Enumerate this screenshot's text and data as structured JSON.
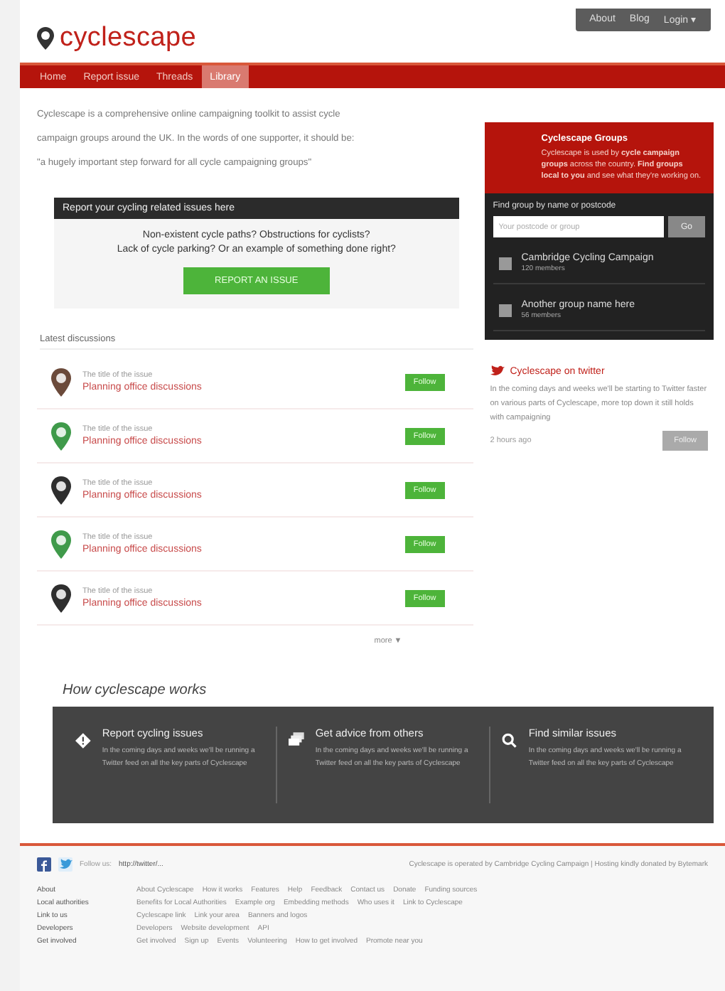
{
  "logo": {
    "text": "cyclescape"
  },
  "top_menu": [
    {
      "label": "About"
    },
    {
      "label": "Blog"
    },
    {
      "label": "Login ▾"
    }
  ],
  "nav_tabs": [
    {
      "label": "Home",
      "selected": false
    },
    {
      "label": "Report issue",
      "selected": false
    },
    {
      "label": "Threads",
      "selected": false
    },
    {
      "label": "Library",
      "selected": true
    }
  ],
  "intro": {
    "lines": [
      "Cyclescape is a comprehensive online campaigning toolkit to assist cycle",
      "campaign groups around the UK. In the words of one supporter, it should be:",
      "\"a hugely important step forward for all cycle campaigning groups\""
    ]
  },
  "report": {
    "title": "Report your cycling related issues here",
    "lines": [
      "Non-existent cycle paths?  Obstructions for cyclists?",
      "Lack of cycle parking?  Or an example of something done right?"
    ],
    "button": "REPORT AN ISSUE"
  },
  "discussions": {
    "title": "Latest discussions",
    "items": [
      {
        "issue": "The title of the issue",
        "thread": "Planning office discussions",
        "color": "#6b4a3a",
        "button": "Follow"
      },
      {
        "issue": "The title of the issue",
        "thread": "Planning office discussions",
        "color": "#3f9a4a",
        "button": "Follow"
      },
      {
        "issue": "The title of the issue",
        "thread": "Planning office discussions",
        "color": "#2e2e2e",
        "button": "Follow"
      },
      {
        "issue": "The title of the issue",
        "thread": "Planning office discussions",
        "color": "#3f9a4a",
        "button": "Follow"
      },
      {
        "issue": "The title of the issue",
        "thread": "Planning office discussions",
        "color": "#2e2e2e",
        "button": "Follow"
      }
    ],
    "more": "more ▼"
  },
  "groups": {
    "title": "Cyclescape Groups",
    "text": "Cyclescape is used by **cycle campaign groups** across the country. **Find groups local to you** and see what they're working on.",
    "search_label": "Find group by name or postcode",
    "search_placeholder": "Your postcode or group",
    "search_button": "Go",
    "items": [
      {
        "name": "Cambridge Cycling Campaign",
        "members": "120 members"
      },
      {
        "name": "Another group name here",
        "members": "56 members"
      }
    ]
  },
  "twitter": {
    "title": "Cyclescape on twitter",
    "text": "In the coming days and weeks we'll be starting to Twitter faster on various parts of Cyclescape, more top down it still holds with campaigning",
    "time": "2 hours ago",
    "button": "Follow"
  },
  "how": {
    "title": "How cyclescape works",
    "features": [
      {
        "kind": "warning",
        "title": "Report cycling issues",
        "text": "In the coming days and weeks we'll be running a Twitter feed on all the key parts of Cyclescape"
      },
      {
        "kind": "cards",
        "title": "Get advice from others",
        "text": "In the coming days and weeks we'll be running a Twitter feed on all the key parts of Cyclescape"
      },
      {
        "kind": "search",
        "title": "Find similar issues",
        "text": "In the coming days and weeks we'll be running a Twitter feed on all the key parts of Cyclescape"
      }
    ]
  },
  "footer": {
    "follow_label": "Follow us:",
    "follow_link": "http://twitter/...",
    "credit": "Cyclescape is operated by Cambridge Cycling Campaign  |  Hosting kindly donated by Bytemark",
    "rows": [
      {
        "heading": "About",
        "links": [
          "About Cyclescape",
          "How it works",
          "Features",
          "Help",
          "Feedback",
          "Contact us",
          "Donate",
          "Funding sources"
        ]
      },
      {
        "heading": "Local authorities",
        "links": [
          "Benefits for Local Authorities",
          "Example org",
          "Embedding methods",
          "Who uses it",
          "Link to Cyclescape"
        ]
      },
      {
        "heading": "Link to us",
        "links": [
          "Cyclescape link",
          "Link your area",
          "Banners and logos"
        ]
      },
      {
        "heading": "Developers",
        "links": [
          "Developers",
          "Website development",
          "API"
        ]
      },
      {
        "heading": "Get involved",
        "links": [
          "Get involved",
          "Sign up",
          "Events",
          "Volunteering",
          "How to get involved",
          "Promote near you"
        ]
      }
    ]
  }
}
